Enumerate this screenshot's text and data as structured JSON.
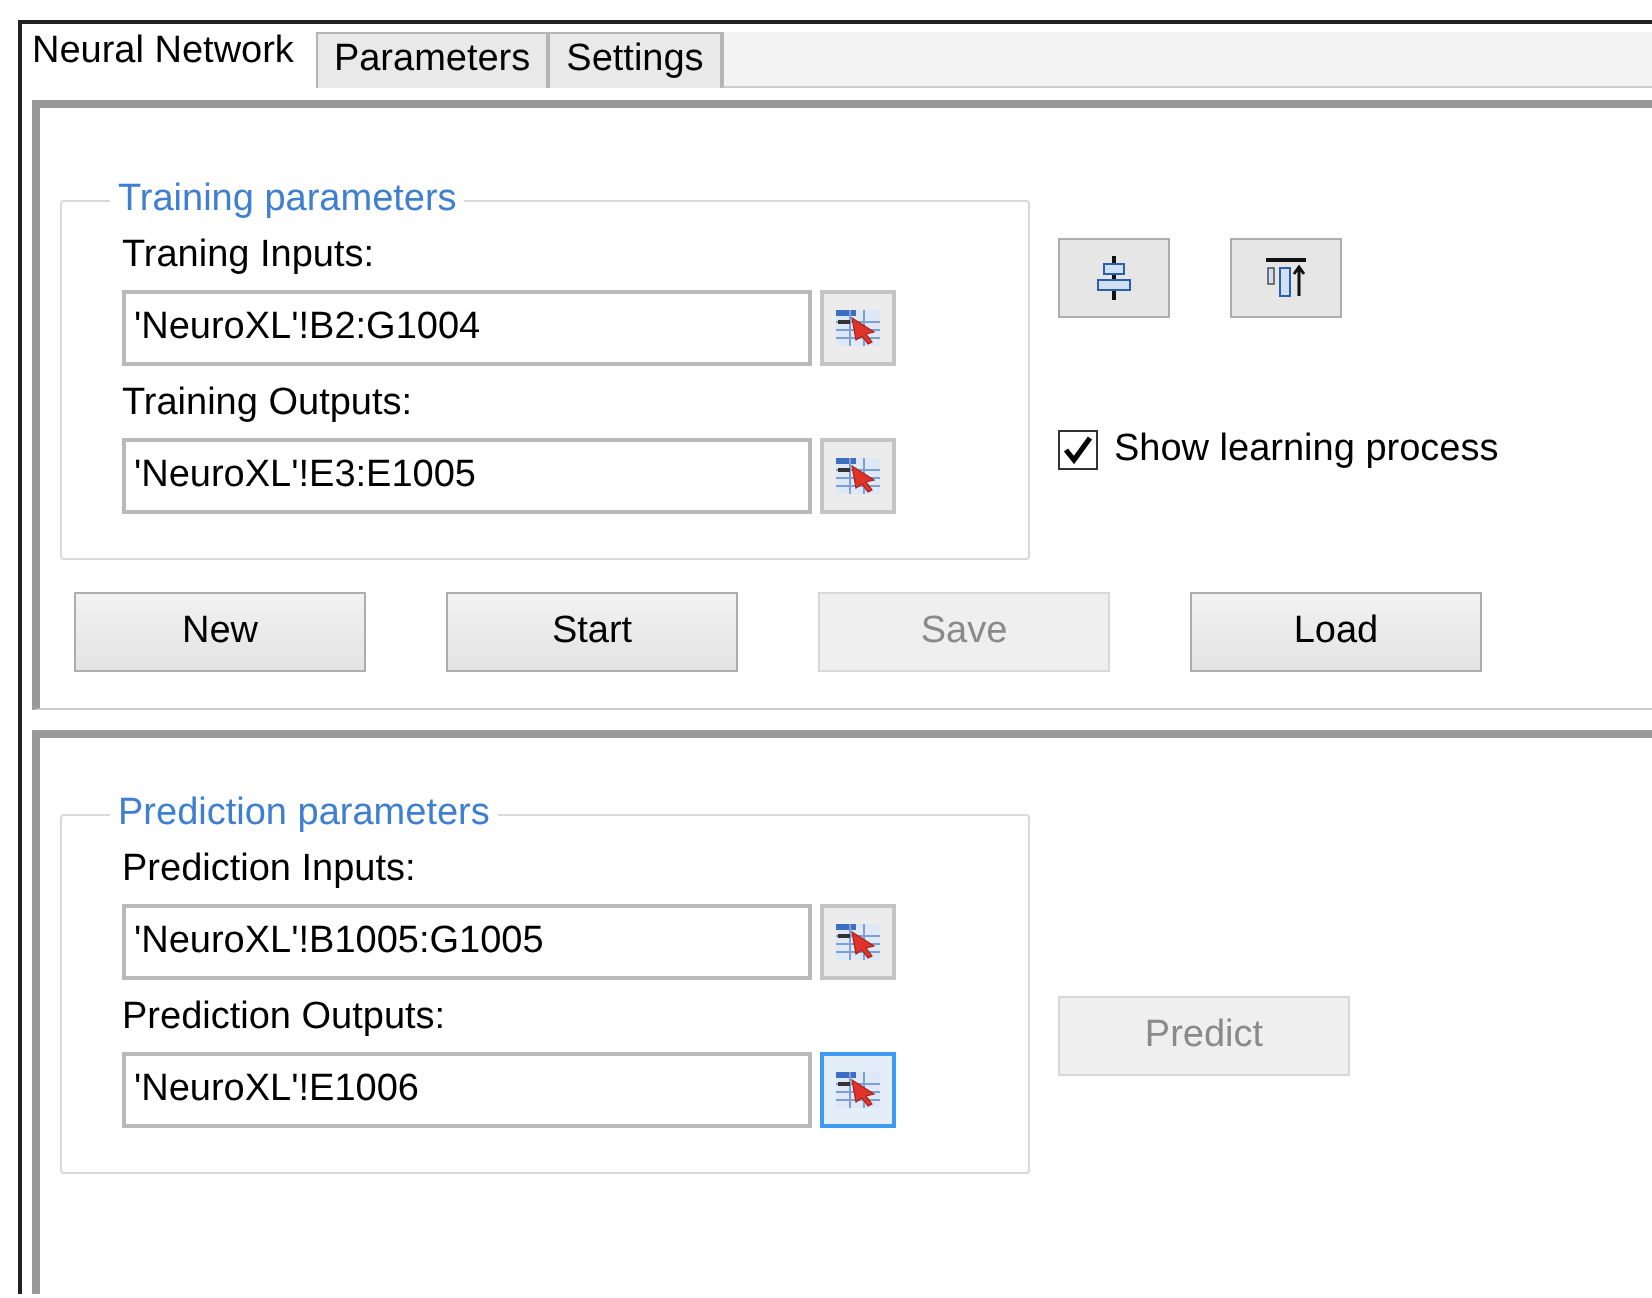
{
  "tabs": [
    {
      "label": "Neural Network",
      "selected": true
    },
    {
      "label": "Parameters",
      "selected": false
    },
    {
      "label": "Settings",
      "selected": false
    }
  ],
  "training": {
    "title": "Training parameters",
    "fields": [
      {
        "label": "Traning Inputs:",
        "value": "'NeuroXL'!B2:G1004",
        "picker_focused": false
      },
      {
        "label": "Training Outputs:",
        "value": "'NeuroXL'!E3:E1005",
        "picker_focused": false
      }
    ],
    "show_learning_process": {
      "label": "Show learning process",
      "checked": true
    },
    "buttons": [
      {
        "label": "New",
        "disabled": false
      },
      {
        "label": "Start",
        "disabled": false
      },
      {
        "label": "Save",
        "disabled": true
      },
      {
        "label": "Load",
        "disabled": false
      }
    ]
  },
  "prediction": {
    "title": "Prediction parameters",
    "fields": [
      {
        "label": "Prediction Inputs:",
        "value": "'NeuroXL'!B1005:G1005",
        "picker_focused": false
      },
      {
        "label": "Prediction Outputs:",
        "value": "'NeuroXL'!E1006",
        "picker_focused": true
      }
    ],
    "predict_button": {
      "label": "Predict",
      "disabled": true
    }
  }
}
